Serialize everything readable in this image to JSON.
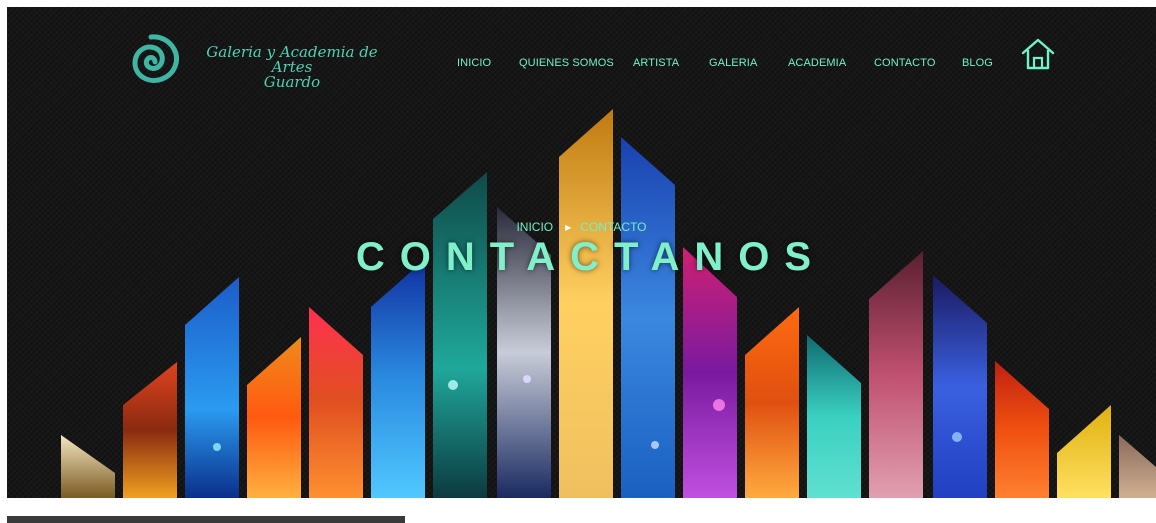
{
  "brand": {
    "logo_line1": "Galeria y Academia de Artes",
    "logo_line2": "Guardo",
    "logo_icon": "spiral-logo-icon",
    "accent_color": "#6ff3c7"
  },
  "nav": {
    "items": [
      {
        "label": "INICIO"
      },
      {
        "label": "QUIENES SOMOS"
      },
      {
        "label": "ARTISTA"
      },
      {
        "label": "GALERIA"
      },
      {
        "label": "ACADEMIA"
      },
      {
        "label": "CONTACTO"
      },
      {
        "label": "BLOG"
      }
    ],
    "home_icon": "home-icon"
  },
  "hero": {
    "breadcrumb": [
      {
        "label": "INICIO"
      },
      {
        "label": "CONTACTO"
      }
    ],
    "breadcrumb_separator_icon": "triangle-right-icon",
    "title": "CONTACTANOS"
  }
}
